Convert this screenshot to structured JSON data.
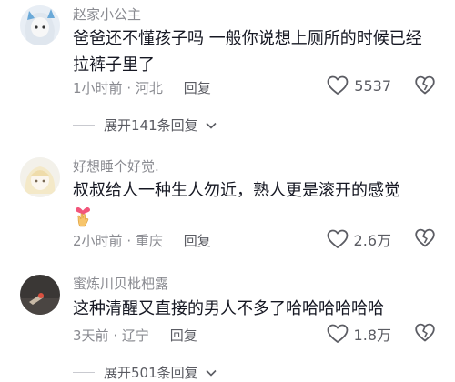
{
  "comments": [
    {
      "username": "赵家小公主",
      "text": "爸爸还不懂孩子吗 一般你说想上厕所的时候已经拉裤子里了",
      "time": "1小时前",
      "location": "河北",
      "reply_label": "回复",
      "likes": "5537",
      "expand_label": "展开141条回复"
    },
    {
      "username": "好想睡个好觉.",
      "text": "叔叔给人一种生人勿近，熟人更是滚开的感觉",
      "time": "2小时前",
      "location": "重庆",
      "reply_label": "回复",
      "likes": "2.6万"
    },
    {
      "username": "蜜炼川贝枇杷露",
      "text": "这种清醒又直接的男人不多了哈哈哈哈哈哈",
      "time": "3天前",
      "location": "辽宁",
      "reply_label": "回复",
      "likes": "1.8万",
      "expand_label": "展开501条回复"
    }
  ],
  "meta_separator": "·",
  "colors": {
    "text": "#161823",
    "secondary": "#8a8b91",
    "divider": "#c9cad0"
  }
}
